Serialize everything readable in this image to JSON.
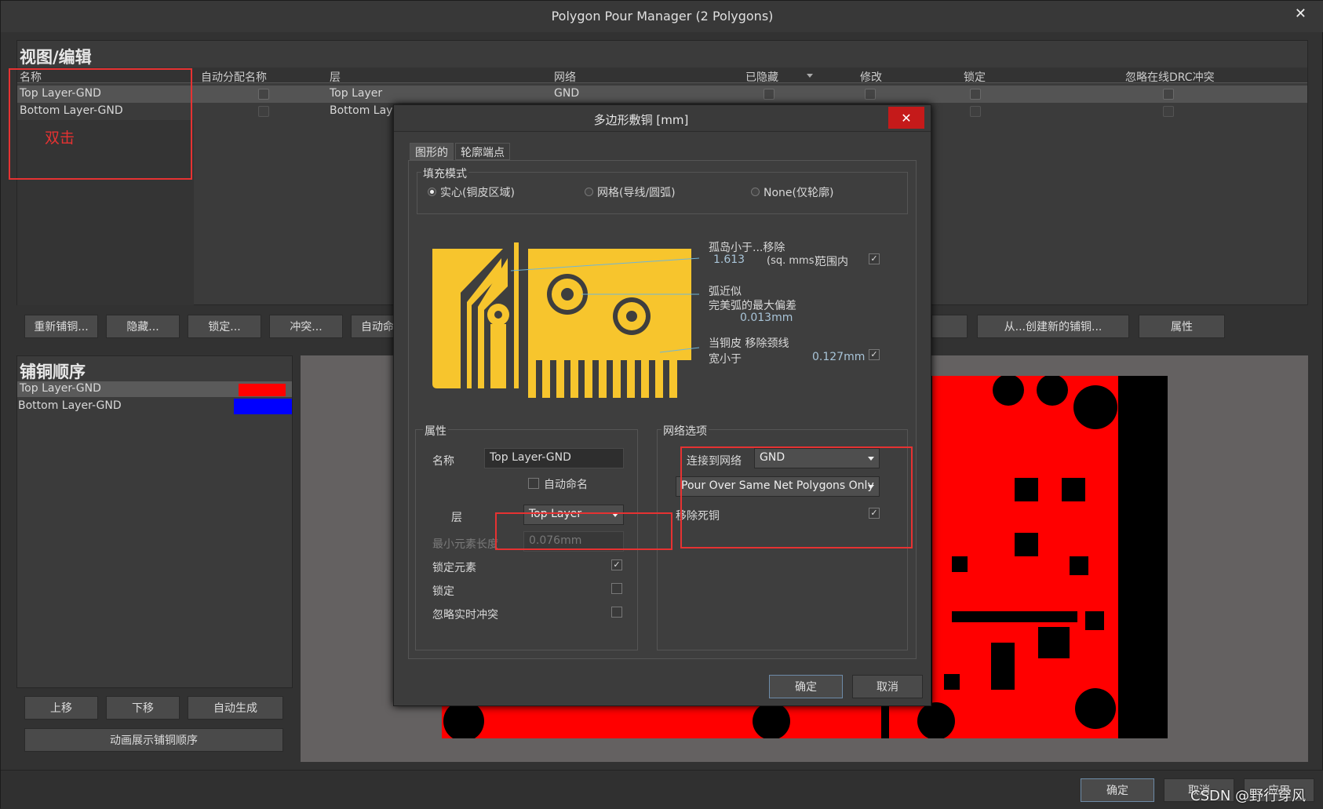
{
  "window": {
    "title": "Polygon Pour Manager (2 Polygons)",
    "close_glyph": "✕"
  },
  "view_edit": {
    "title": "视图/编辑",
    "columns": {
      "name": "名称",
      "auto_name": "自动分配名称",
      "layer": "层",
      "net": "网络",
      "hidden": "已隐藏",
      "modified": "修改",
      "locked": "锁定",
      "ignore_drc": "忽略在线DRC冲突"
    },
    "rows": [
      {
        "name": "Top Layer-GND",
        "layer": "Top Layer",
        "net": "GND"
      },
      {
        "name": "Bottom Layer-GND",
        "layer": "Bottom Layer",
        "net": ""
      }
    ],
    "annotation": "双击"
  },
  "toolbar": {
    "repour": "重新铺铜...",
    "hide": "隐藏...",
    "lock": "锁定...",
    "violation": "冲突...",
    "auto": "自动命",
    "create_from": "从...创建新的铺铜...",
    "properties": "属性"
  },
  "pour_order": {
    "title": "铺铜顺序",
    "rows": [
      {
        "name": "Top Layer-GND",
        "color": "#ff0000"
      },
      {
        "name": "Bottom Layer-GND",
        "color": "#0000ff"
      }
    ],
    "move_up": "上移",
    "move_down": "下移",
    "auto_generate": "自动生成",
    "animate": "动画展示铺铜顺序"
  },
  "footer": {
    "ok": "确定",
    "cancel": "取消",
    "apply": "应用",
    "watermark": "CSDN @野行穿风"
  },
  "dialog": {
    "title": "多边形敷铜 [mm]",
    "close_glyph": "✕",
    "tabs": [
      "图形的",
      "轮廓端点"
    ],
    "fill_mode": {
      "title": "填充模式",
      "options": [
        "实心(铜皮区域)",
        "网格(导线/圆弧)",
        "None(仅轮廓)"
      ]
    },
    "island": {
      "label": "孤岛小于...移除",
      "value": "1.613",
      "unit": "(sq. mms)",
      "suffix": "范围内"
    },
    "arc": {
      "label1": "弧近似",
      "label2": "完美弧的最大偏差",
      "value": "0.013mm"
    },
    "neck": {
      "label1": "当铜皮  移除颈线",
      "label2": "宽小于",
      "value": "0.127mm"
    },
    "properties": {
      "title": "属性",
      "name_label": "名称",
      "name_value": "Top Layer-GND",
      "auto_name": "自动命名",
      "layer_label": "层",
      "layer_value": "Top Layer",
      "min_len_label": "最小元素长度",
      "min_len_value": "0.076mm",
      "lock_prims": "锁定元素",
      "lock": "锁定",
      "ignore_online": "忽略实时冲突"
    },
    "net_options": {
      "title": "网络选项",
      "connect_label": "连接到网络",
      "connect_value": "GND",
      "pour_over": "Pour Over Same Net Polygons Only",
      "remove_dead": "移除死铜"
    },
    "ok": "确定",
    "cancel": "取消"
  },
  "colors": {
    "accent_red": "#e63232",
    "pour_yellow": "#f7c52d",
    "pcb_red": "#ff0000"
  }
}
